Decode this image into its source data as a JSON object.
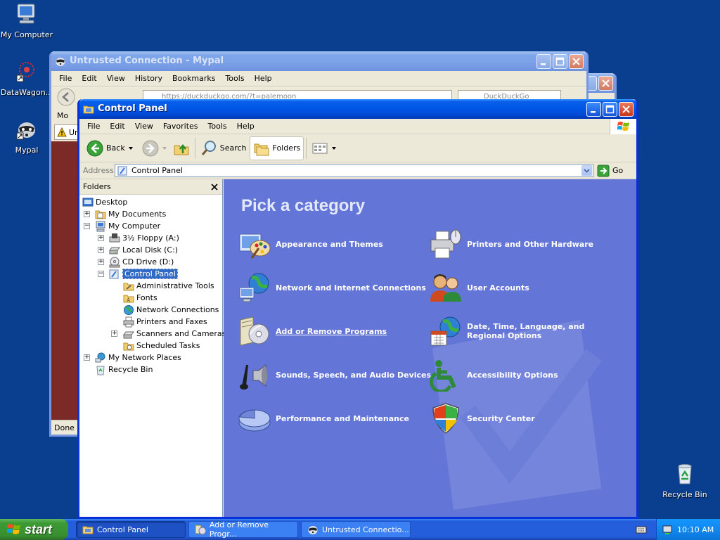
{
  "desktop": {
    "icons": [
      {
        "label": "My Computer"
      },
      {
        "label": "DataWagon..."
      },
      {
        "label": "Mypal"
      },
      {
        "label": "Recycle Bin"
      }
    ]
  },
  "mypal_window": {
    "title": "Untrusted Connection - Mypal",
    "menu": [
      "File",
      "Edit",
      "View",
      "History",
      "Bookmarks",
      "Tools",
      "Help"
    ],
    "url_partial": "https://duckduckgo.com/?t=palemoon",
    "search_partial": "DuckDuckGo",
    "bookmarks_partial": "Mo",
    "tab_partial": "Un",
    "status": "Done"
  },
  "control_panel": {
    "title": "Control Panel",
    "menu": [
      "File",
      "Edit",
      "View",
      "Favorites",
      "Tools",
      "Help"
    ],
    "toolbar": {
      "back": "Back",
      "search": "Search",
      "folders": "Folders"
    },
    "address": {
      "label": "Address",
      "value": "Control Panel",
      "go": "Go"
    },
    "folders_pane": {
      "title": "Folders",
      "tree": [
        {
          "label": "Desktop"
        },
        {
          "label": "My Documents"
        },
        {
          "label": "My Computer"
        },
        {
          "label": "3½ Floppy (A:)"
        },
        {
          "label": "Local Disk (C:)"
        },
        {
          "label": "CD Drive (D:)"
        },
        {
          "label": "Control Panel"
        },
        {
          "label": "Administrative Tools"
        },
        {
          "label": "Fonts"
        },
        {
          "label": "Network Connections"
        },
        {
          "label": "Printers and Faxes"
        },
        {
          "label": "Scanners and Cameras"
        },
        {
          "label": "Scheduled Tasks"
        },
        {
          "label": "My Network Places"
        },
        {
          "label": "Recycle Bin"
        }
      ]
    },
    "category_heading": "Pick a category",
    "categories": [
      {
        "label": "Appearance and Themes",
        "icon": "appearance-icon"
      },
      {
        "label": "Printers and Other Hardware",
        "icon": "printer-icon"
      },
      {
        "label": "Network and Internet Connections",
        "icon": "network-icon"
      },
      {
        "label": "User Accounts",
        "icon": "users-icon"
      },
      {
        "label": "Add or Remove Programs",
        "icon": "add-remove-icon"
      },
      {
        "label": "Date, Time, Language, and Regional Options",
        "icon": "date-time-icon"
      },
      {
        "label": "Sounds, Speech, and Audio Devices",
        "icon": "sound-icon"
      },
      {
        "label": "Accessibility Options",
        "icon": "accessibility-icon"
      },
      {
        "label": "Performance and Maintenance",
        "icon": "performance-icon"
      },
      {
        "label": "Security Center",
        "icon": "shield-icon"
      }
    ]
  },
  "taskbar": {
    "start": "start",
    "buttons": [
      {
        "label": "Control Panel"
      },
      {
        "label": "Add or Remove Progr..."
      },
      {
        "label": "Untrusted Connectio..."
      }
    ],
    "clock": "10:10 AM"
  },
  "colors": {
    "desktop": "#0a3e8e",
    "category_pane": "#6375d6",
    "titlebar_active": "#0058e6",
    "start_green": "#3c9a34"
  }
}
